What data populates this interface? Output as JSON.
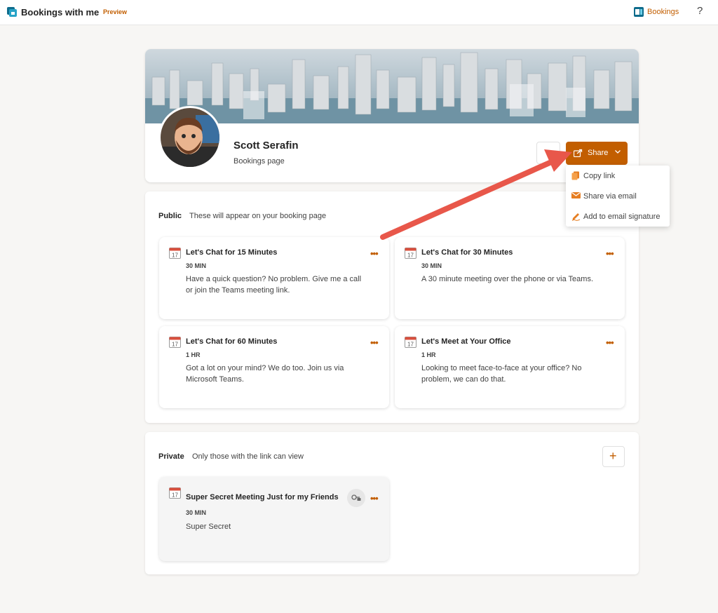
{
  "app": {
    "title": "Bookings with me",
    "badge": "Preview",
    "bookings_link": "Bookings",
    "help": "?"
  },
  "profile": {
    "name": "Scott Serafin",
    "subtitle": "Bookings page"
  },
  "share": {
    "button_label": "Share",
    "menu": [
      {
        "label": "Copy link",
        "icon": "copy-icon"
      },
      {
        "label": "Share via email",
        "icon": "mail-icon"
      },
      {
        "label": "Add to email signature",
        "icon": "signature-pen-icon"
      }
    ]
  },
  "public_section": {
    "label": "Public",
    "description": "These will appear on your booking page",
    "services": [
      {
        "title": "Let's Chat for 15 Minutes",
        "duration": "30 MIN",
        "description": "Have a quick question? No problem. Give me a call or join the Teams meeting link."
      },
      {
        "title": "Let's Chat for 30 Minutes",
        "duration": "30 MIN",
        "description": "A 30 minute meeting over the phone or via Teams."
      },
      {
        "title": "Let's Chat for 60 Minutes",
        "duration": "1 HR",
        "description": "Got a lot on your mind? We do too. Join us via Microsoft Teams."
      },
      {
        "title": "Let's Meet at Your Office",
        "duration": "1 HR",
        "description": "Looking to meet face-to-face at your office? No problem, we can do that."
      }
    ]
  },
  "private_section": {
    "label": "Private",
    "description": "Only those with the link can view",
    "add_label": "+",
    "services": [
      {
        "title": "Super Secret Meeting Just for my Friends",
        "duration": "30 MIN",
        "description": "Super Secret"
      }
    ]
  },
  "more_label": "•••",
  "calendar_day": "17",
  "colors": {
    "accent": "#c25e00",
    "arrow": "#e8574a",
    "background": "#f7f6f4"
  }
}
